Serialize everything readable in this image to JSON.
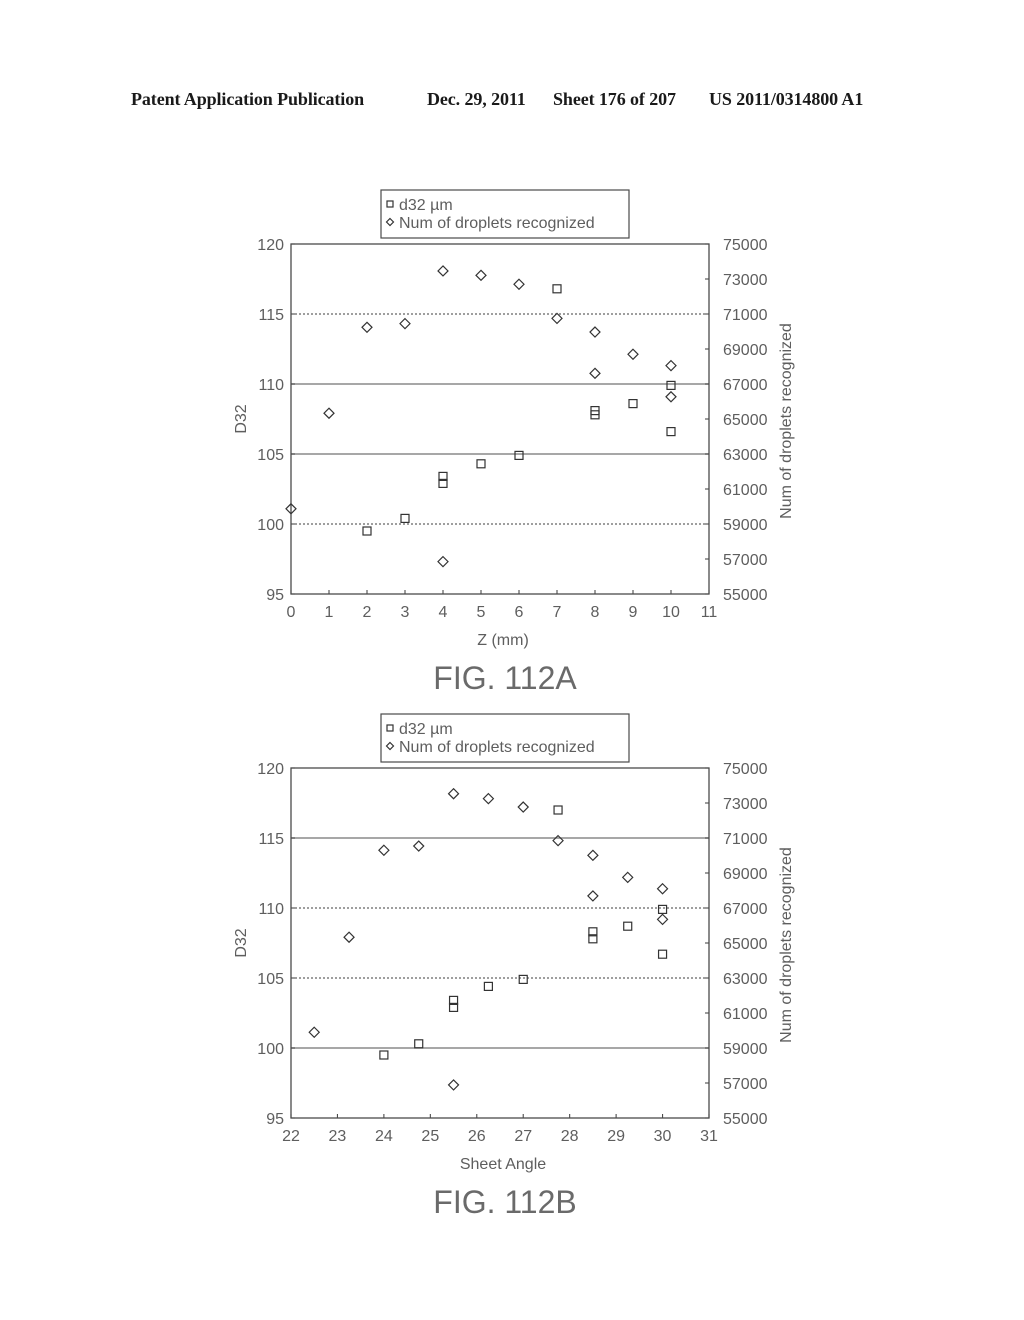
{
  "header": {
    "publication": "Patent Application Publication",
    "date": "Dec. 29, 2011",
    "sheet": "Sheet 176 of 207",
    "number": "US 2011/0314800 A1"
  },
  "chart_data": [
    {
      "type": "scatter",
      "title": "FIG. 112A",
      "xlabel": "Z (mm)",
      "ylabel": "D32",
      "y2label": "Num of droplets recognized",
      "xlim": [
        0,
        11
      ],
      "ylim": [
        95,
        120
      ],
      "y2lim": [
        55000,
        75000
      ],
      "xticks": [
        0,
        1,
        2,
        3,
        4,
        5,
        6,
        7,
        8,
        9,
        10,
        11
      ],
      "yticks": [
        95,
        100,
        105,
        110,
        115,
        120
      ],
      "y2ticks": [
        55000,
        57000,
        59000,
        61000,
        63000,
        65000,
        67000,
        69000,
        71000,
        73000,
        75000
      ],
      "grid": true,
      "legend": {
        "position": "top-center",
        "entries": [
          {
            "label": "d32 µm",
            "marker": "square"
          },
          {
            "label": "Num of droplets recognized",
            "marker": "diamond"
          }
        ]
      },
      "series": [
        {
          "name": "d32 µm",
          "marker": "square",
          "axis": "left",
          "x": [
            2,
            3,
            4,
            4,
            5,
            6,
            7,
            8,
            8,
            9,
            10,
            10
          ],
          "y": [
            99.5,
            100.4,
            102.9,
            103.4,
            104.3,
            104.9,
            116.8,
            107.8,
            108.1,
            108.6,
            106.6,
            109.9
          ]
        },
        {
          "name": "Num of droplets recognized",
          "marker": "diamond",
          "axis": "right",
          "x": [
            0,
            1,
            2,
            3,
            4,
            4,
            5,
            6,
            7,
            8,
            8,
            9,
            10,
            10
          ],
          "y": [
            59870,
            65330,
            70240,
            70450,
            73460,
            56850,
            73210,
            72700,
            70750,
            69970,
            67610,
            68700,
            68050,
            66270
          ]
        }
      ]
    },
    {
      "type": "scatter",
      "title": "FIG. 112B",
      "xlabel": "Sheet Angle",
      "ylabel": "D32",
      "y2label": "Num of droplets recognized",
      "xlim": [
        22,
        31
      ],
      "ylim": [
        95,
        120
      ],
      "y2lim": [
        55000,
        75000
      ],
      "xticks": [
        22,
        23,
        24,
        25,
        26,
        27,
        28,
        29,
        30,
        31
      ],
      "yticks": [
        95,
        100,
        105,
        110,
        115,
        120
      ],
      "y2ticks": [
        55000,
        57000,
        59000,
        61000,
        63000,
        65000,
        67000,
        69000,
        71000,
        73000,
        75000
      ],
      "grid": true,
      "legend": {
        "position": "top-center",
        "entries": [
          {
            "label": "d32 µm",
            "marker": "square"
          },
          {
            "label": "Num of droplets recognized",
            "marker": "diamond"
          }
        ]
      },
      "series": [
        {
          "name": "d32 µm",
          "marker": "square",
          "axis": "left",
          "x": [
            24,
            24.75,
            25.5,
            25.5,
            26.25,
            27,
            27.75,
            28.5,
            28.5,
            29.25,
            30,
            30
          ],
          "y": [
            99.5,
            100.3,
            102.9,
            103.4,
            104.4,
            104.9,
            117.0,
            107.8,
            108.3,
            108.7,
            106.7,
            109.9
          ]
        },
        {
          "name": "Num of droplets recognized",
          "marker": "diamond",
          "axis": "right",
          "x": [
            22.5,
            23.25,
            24,
            24.75,
            25.5,
            25.5,
            26.25,
            27,
            27.75,
            28.5,
            28.5,
            29.25,
            30,
            30
          ],
          "y": [
            59900,
            65330,
            70300,
            70540,
            73530,
            56890,
            73250,
            72770,
            70850,
            70010,
            67690,
            68750,
            68100,
            66350
          ]
        }
      ]
    }
  ]
}
